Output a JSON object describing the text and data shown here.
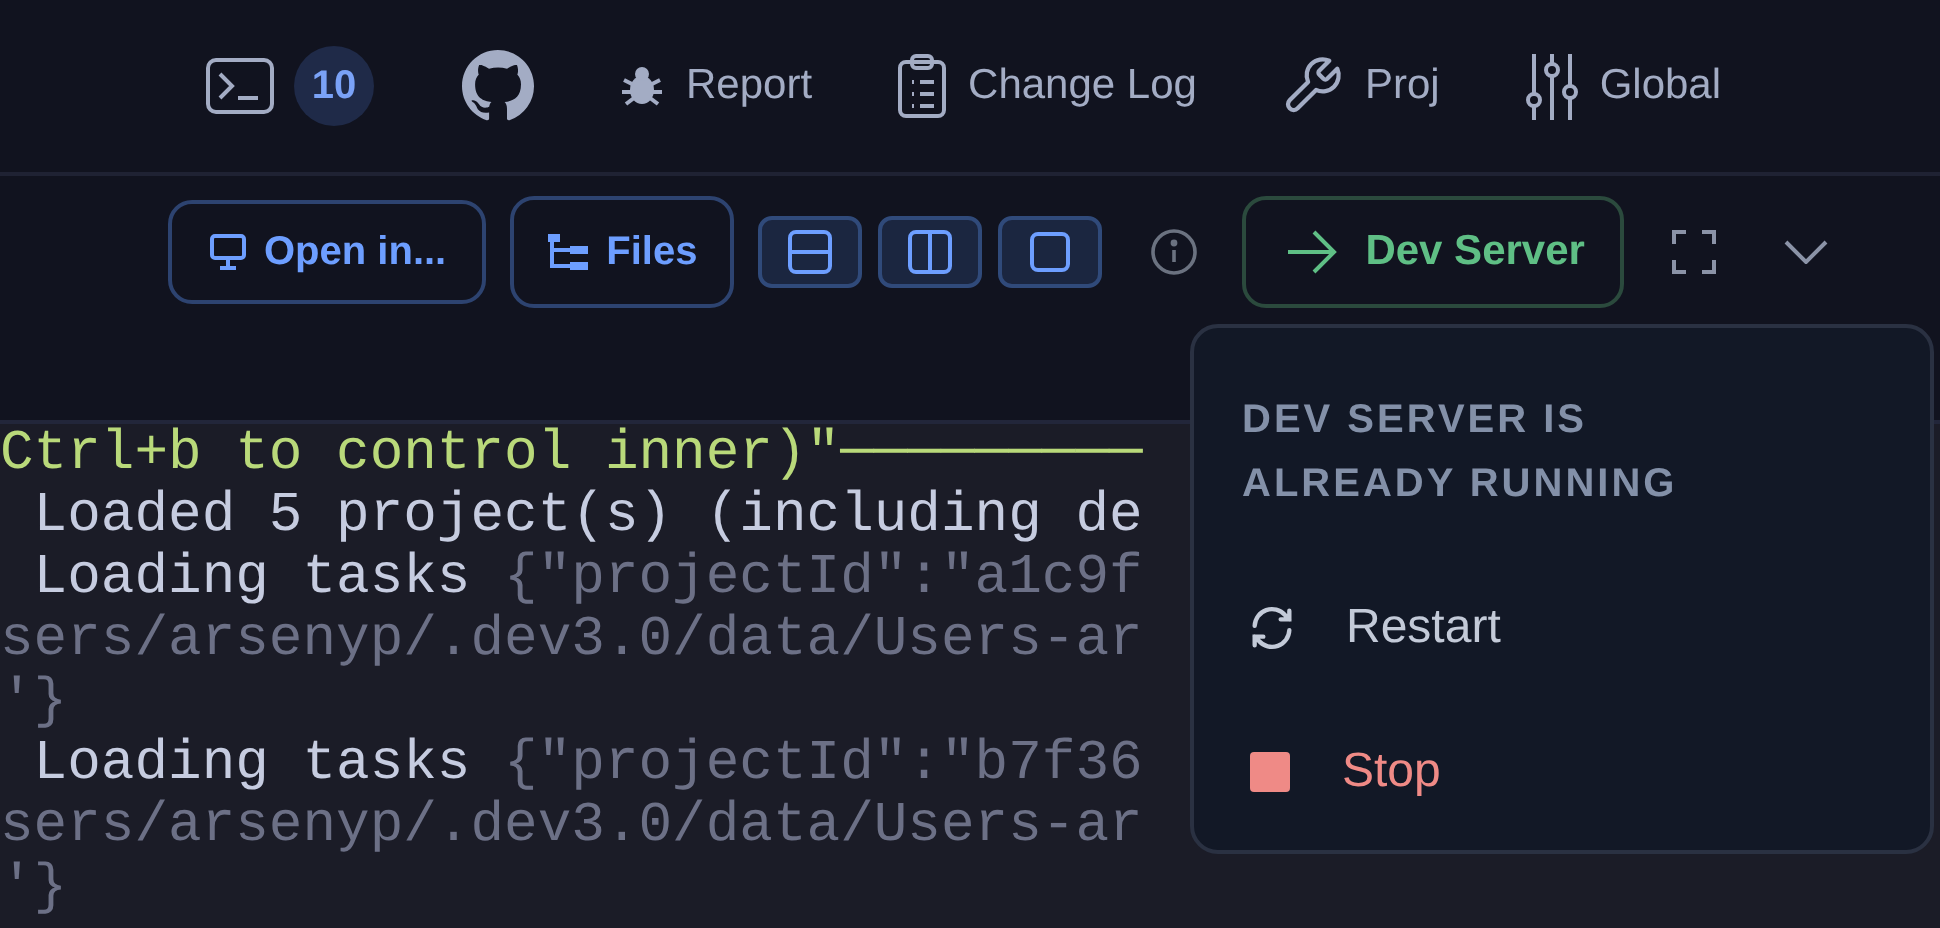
{
  "top_bar": {
    "items": [
      {
        "kind": "terminal",
        "badge": "10"
      },
      {
        "kind": "github"
      },
      {
        "kind": "bug",
        "label": "Report"
      },
      {
        "kind": "clipboard",
        "label": "Change Log"
      },
      {
        "kind": "wrench",
        "label": "Proj"
      },
      {
        "kind": "sliders",
        "label": "Global"
      }
    ]
  },
  "toolbar": {
    "open_in": "Open in...",
    "files": "Files",
    "layouts": [
      {
        "kind": "rows"
      },
      {
        "kind": "columns"
      },
      {
        "kind": "single"
      }
    ],
    "dev_server": "Dev Server"
  },
  "terminal": {
    "lines": [
      [
        {
          "kind": "green",
          "text": "Ctrl+b to control inner)\"─────────"
        }
      ],
      [
        {
          "kind": "plain",
          "text": " Loaded 5 project(s) (including de"
        }
      ],
      [
        {
          "kind": "plain",
          "text": " Loading tasks "
        },
        {
          "kind": "dim",
          "text": "{\"projectId\":\"a1c9f"
        }
      ],
      [
        {
          "kind": "dim",
          "text": "sers/arsenyp/.dev3.0/data/Users-ar"
        }
      ],
      [
        {
          "kind": "dim",
          "text": "'}"
        }
      ],
      [
        {
          "kind": "plain",
          "text": " Loading tasks "
        },
        {
          "kind": "dim",
          "text": "{\"projectId\":\"b7f36"
        }
      ],
      [
        {
          "kind": "dim",
          "text": "sers/arsenyp/.dev3.0/data/Users-ar"
        }
      ],
      [
        {
          "kind": "dim",
          "text": "'}"
        }
      ]
    ]
  },
  "menu": {
    "header": "DEV SERVER IS ALREADY RUNNING",
    "items": [
      {
        "kind": "restart",
        "label": "Restart"
      },
      {
        "kind": "stop",
        "label": "Stop"
      }
    ]
  }
}
